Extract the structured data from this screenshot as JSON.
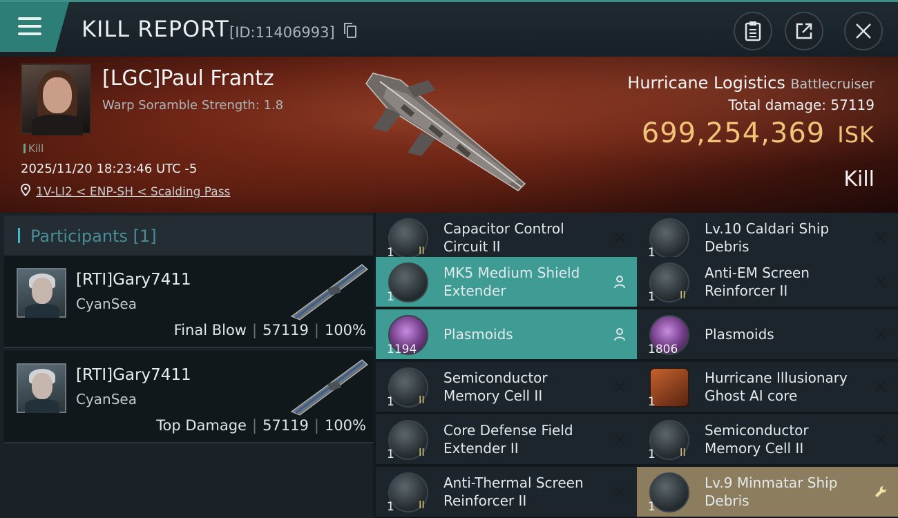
{
  "header": {
    "title": "KILL REPORT",
    "report_id": "[ID:11406993]",
    "icons": [
      "menu-icon",
      "copy-icon",
      "clipboard-icon",
      "share-icon",
      "close-icon"
    ]
  },
  "victim": {
    "name": "[LGC]Paul Frantz",
    "warp": "Warp Soramble Strength: 1.8",
    "tag": "Kill",
    "datetime": "2025/11/20 18:23:46 UTC -5",
    "location": "1V-LI2 < ENP-SH < Scalding Pass",
    "ship_name": "Hurricane Logistics",
    "ship_class": "Battlecruiser",
    "total_damage_label": "Total damage:",
    "total_damage": "57119",
    "isk_value": "699,254,369",
    "isk_unit": "ISK",
    "result": "Kill"
  },
  "participants": {
    "title": "Participants",
    "count": "[1]",
    "rows": [
      {
        "name": "[RTI]Gary7411",
        "corp": "CyanSea",
        "role": "Final Blow",
        "damage": "57119",
        "percent": "100%"
      },
      {
        "name": "[RTI]Gary7411",
        "corp": "CyanSea",
        "role": "Top Damage",
        "damage": "57119",
        "percent": "100%"
      }
    ]
  },
  "items": {
    "left": [
      {
        "name": "Capacitor Control Circuit II",
        "qty": "1",
        "meta": "II",
        "state": "destroyed"
      },
      {
        "name": "MK5 Medium Shield Extender",
        "qty": "1",
        "meta": "",
        "state": "dropped"
      },
      {
        "name": "Plasmoids",
        "qty": "1194",
        "meta": "",
        "state": "dropped"
      },
      {
        "name": "Semiconductor Memory Cell II",
        "qty": "1",
        "meta": "II",
        "state": "destroyed"
      },
      {
        "name": "Core Defense Field Extender II",
        "qty": "1",
        "meta": "II",
        "state": "destroyed"
      },
      {
        "name": "Anti-Thermal Screen Reinforcer II",
        "qty": "1",
        "meta": "II",
        "state": "destroyed"
      }
    ],
    "right": [
      {
        "name": "Lv.10 Caldari Ship Debris",
        "qty": "1",
        "meta": "",
        "state": "destroyed"
      },
      {
        "name": "Anti-EM Screen Reinforcer II",
        "qty": "1",
        "meta": "II",
        "state": "destroyed"
      },
      {
        "name": "Plasmoids",
        "qty": "1806",
        "meta": "",
        "state": "destroyed"
      },
      {
        "name": "Hurricane Illusionary Ghost AI core",
        "qty": "1",
        "meta": "",
        "state": "destroyed"
      },
      {
        "name": "Semiconductor Memory Cell II",
        "qty": "1",
        "meta": "II",
        "state": "destroyed"
      },
      {
        "name": "Lv.9 Minmatar Ship Debris",
        "qty": "1",
        "meta": "",
        "state": "tool"
      }
    ]
  },
  "colors": {
    "accent": "#3f9c95",
    "isk": "#f1c478",
    "dropped": "#3f9c95",
    "special": "#8c7d5e"
  }
}
